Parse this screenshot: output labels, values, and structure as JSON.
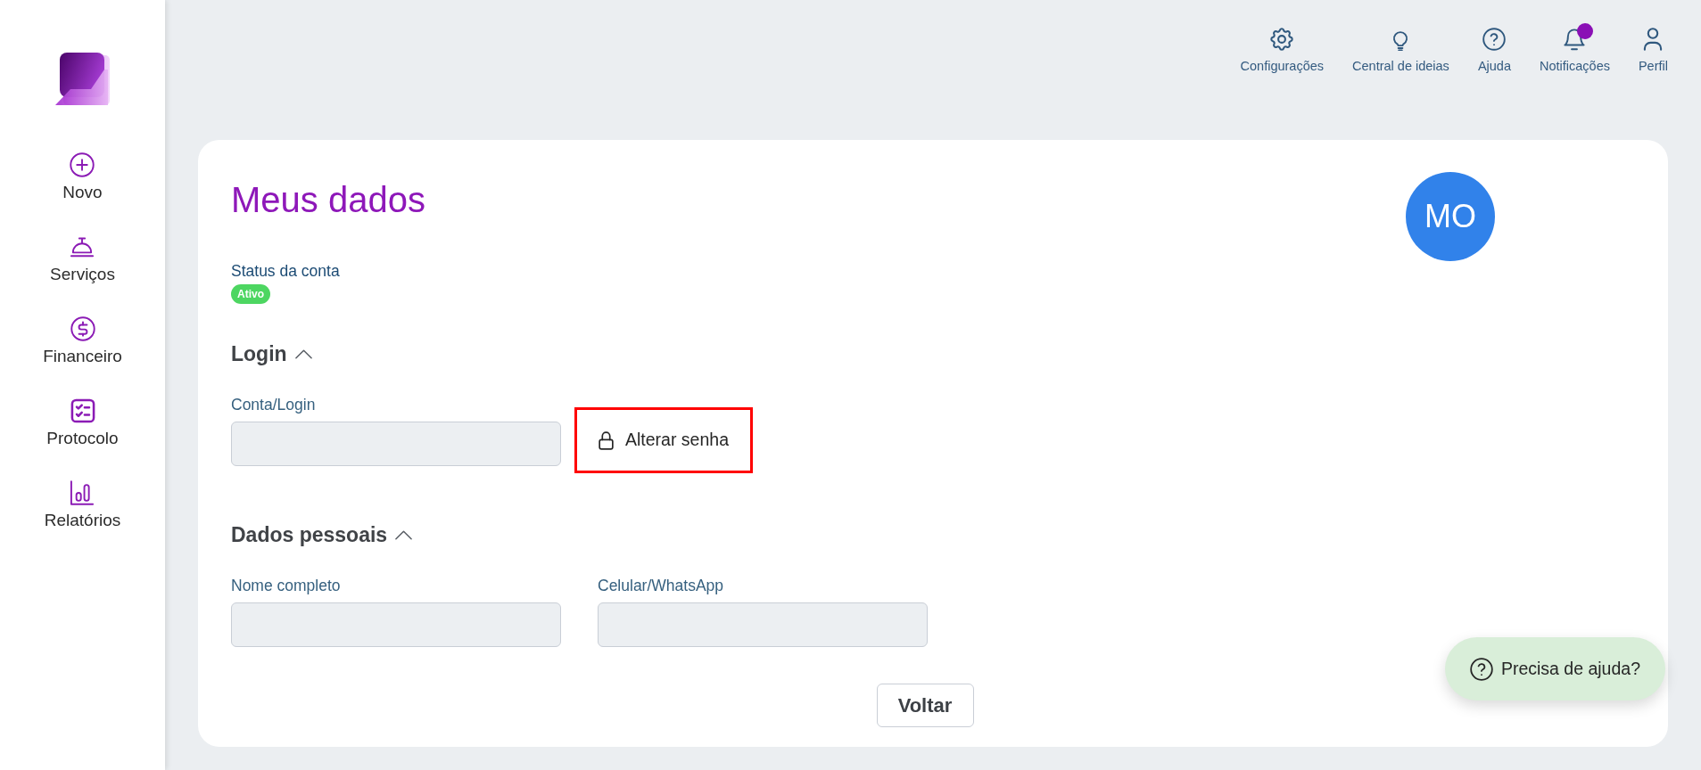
{
  "sidebar": {
    "items": [
      {
        "label": "Novo"
      },
      {
        "label": "Serviços"
      },
      {
        "label": "Financeiro"
      },
      {
        "label": "Protocolo"
      },
      {
        "label": "Relatórios"
      }
    ]
  },
  "header": {
    "items": [
      {
        "label": "Configurações",
        "alert": false
      },
      {
        "label": "Central de ideias",
        "alert": false
      },
      {
        "label": "Ajuda",
        "alert": false
      },
      {
        "label": "Notificações",
        "alert": true
      },
      {
        "label": "Perfil",
        "alert": false
      }
    ]
  },
  "page": {
    "title": "Meus dados",
    "avatar": {
      "initials": "MO"
    },
    "account_status": {
      "label": "Status da conta",
      "value": "Ativo"
    },
    "sections": [
      {
        "title": "Login",
        "expanded": true,
        "fields": [
          {
            "label": "Conta/Login"
          }
        ],
        "action": {
          "label": "Alterar senha",
          "highlighted": true
        }
      },
      {
        "title": "Dados pessoais",
        "expanded": true,
        "fields": [
          {
            "label": "Nome completo"
          },
          {
            "label": "Celular/WhatsApp"
          }
        ]
      }
    ],
    "back_button": {
      "label": "Voltar"
    }
  },
  "help_button": {
    "label": "Precisa de ajuda?"
  }
}
